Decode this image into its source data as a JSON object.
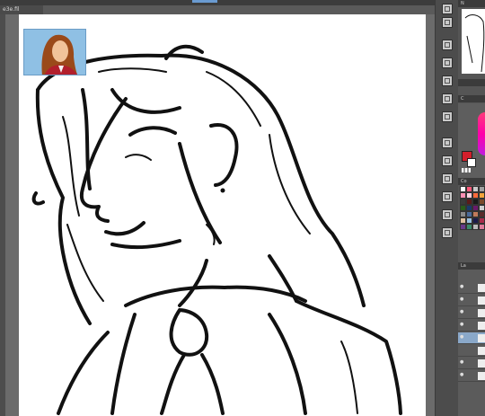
{
  "document": {
    "tab_label": "e3e.fil",
    "reference_label": ""
  },
  "toolbar": {
    "tools": [
      {
        "name": "hand-tool-icon"
      },
      {
        "name": "zoom-tool-icon"
      },
      {
        "name": "operation-tool-icon"
      },
      {
        "name": "move-layer-icon"
      },
      {
        "name": "selection-tool-icon"
      },
      {
        "name": "lasso-tool-icon"
      },
      {
        "name": "eyedropper-tool-icon"
      },
      {
        "name": "pen-tool-icon"
      },
      {
        "name": "pencil-tool-icon"
      },
      {
        "name": "brush-tool-icon"
      },
      {
        "name": "airbrush-tool-icon"
      },
      {
        "name": "decoration-tool-icon"
      },
      {
        "name": "eraser-tool-icon"
      }
    ]
  },
  "panels": {
    "navigator_title": "N",
    "color_title": "C",
    "palette_title": "Co",
    "layer_title": "La",
    "main_color": "#d31f2c",
    "sub_color": "#ffffff",
    "palette": [
      "#ffffff",
      "#ff5a7a",
      "#c8c8c8",
      "#a0a0a0",
      "#ff8fb3",
      "#ffd1e0",
      "#ff6a3b",
      "#f2a33a",
      "#3a3a3a",
      "#5c1a1a",
      "#1a1a1a",
      "#7a4a2a",
      "#2a5c1a",
      "#1a3a6a",
      "#6a1a6a",
      "#d0d0d0",
      "#8a8a8a",
      "#4a6a9a",
      "#c07a5a",
      "#5a2a2a",
      "#e0c0a0",
      "#9ac0e0",
      "#1a1a4a",
      "#aa2a4a",
      "#6a3a8a",
      "#3a8a6a",
      "#bababa",
      "#e07a9a"
    ]
  },
  "layers": [
    {
      "visible": true,
      "selected": false
    },
    {
      "visible": true,
      "selected": false
    },
    {
      "visible": true,
      "selected": false
    },
    {
      "visible": true,
      "selected": false
    },
    {
      "visible": true,
      "selected": true
    },
    {
      "visible": false,
      "selected": false
    },
    {
      "visible": true,
      "selected": false
    },
    {
      "visible": true,
      "selected": false
    }
  ]
}
